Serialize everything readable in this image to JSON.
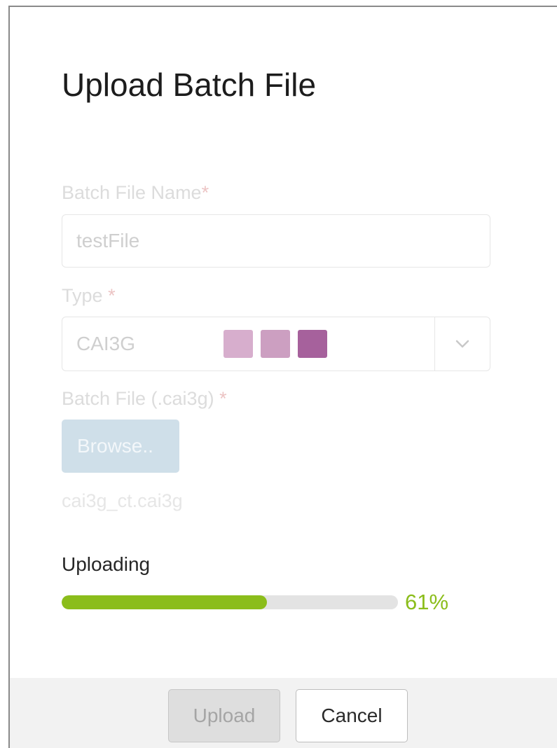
{
  "dialog": {
    "title": "Upload Batch File"
  },
  "form": {
    "name_label": "Batch File Name",
    "name_required": "*",
    "name_value": "testFile",
    "type_label": "Type",
    "type_required": "*",
    "type_value": "CAI3G",
    "type_swatches": [
      "#d7aecd",
      "#cc9fc1",
      "#a6619c"
    ],
    "type_dropdown_icon": "chevron-down-icon",
    "file_label": "Batch File (.cai3g)",
    "file_required": "*",
    "browse_label": "Browse..",
    "selected_file": "cai3g_ct.cai3g"
  },
  "progress": {
    "label": "Uploading",
    "percent": 61,
    "percent_text": "61%",
    "color": "#8bbd1b"
  },
  "footer": {
    "upload_label": "Upload",
    "cancel_label": "Cancel"
  }
}
